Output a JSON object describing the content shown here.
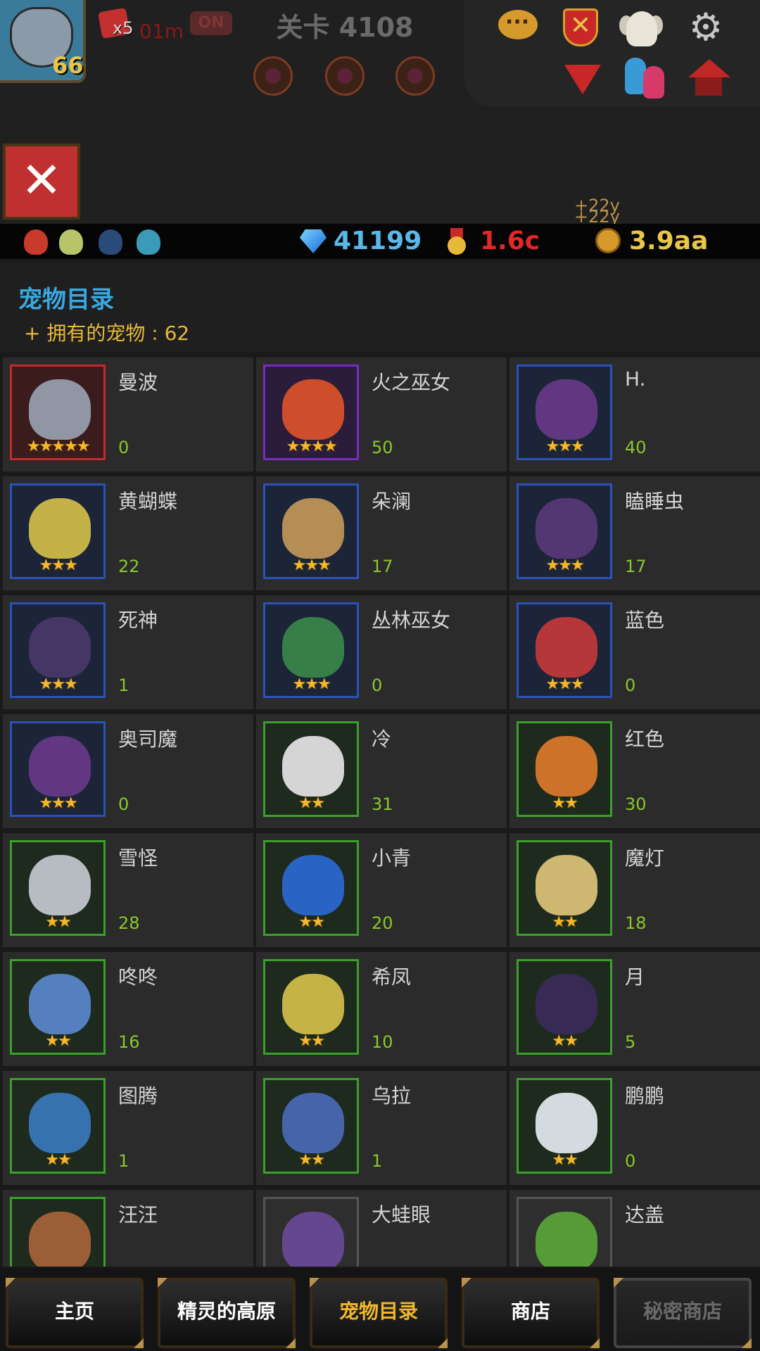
{
  "hud": {
    "level": "66",
    "boost_count": "x5",
    "boost_time": "01m",
    "boost_toggle": "ON",
    "stage_label": "关卡 4108",
    "floating_texts": [
      "+22y",
      "+22y"
    ]
  },
  "resources": {
    "gems": "41199",
    "medals": "1.6c",
    "gold": "3.9aa",
    "colors": {
      "gems": "#5ab8e8",
      "medals": "#e02828",
      "gold": "#e8c64a"
    }
  },
  "catalog": {
    "title": "宠物目录",
    "owned_label": "+ 拥有的宠物 : 62"
  },
  "pets": [
    {
      "name": "曼波",
      "count": "0",
      "stars": 5,
      "rarity": "red",
      "color": "#9aa4b4"
    },
    {
      "name": "火之巫女",
      "count": "50",
      "stars": 4,
      "rarity": "purple",
      "color": "#e0542a"
    },
    {
      "name": "H.",
      "count": "40",
      "stars": 3,
      "rarity": "blue",
      "color": "#6a3a8a"
    },
    {
      "name": "黄蝴蝶",
      "count": "22",
      "stars": 3,
      "rarity": "blue",
      "color": "#d6c24a"
    },
    {
      "name": "朵澜",
      "count": "17",
      "stars": 3,
      "rarity": "blue",
      "color": "#c69a5a"
    },
    {
      "name": "瞌睡虫",
      "count": "17",
      "stars": 3,
      "rarity": "blue",
      "color": "#5a3a7a"
    },
    {
      "name": "死神",
      "count": "1",
      "stars": 3,
      "rarity": "blue",
      "color": "#4a3a6a"
    },
    {
      "name": "丛林巫女",
      "count": "0",
      "stars": 3,
      "rarity": "blue",
      "color": "#3a8a4a"
    },
    {
      "name": "蓝色",
      "count": "0",
      "stars": 3,
      "rarity": "blue",
      "color": "#c83a3a"
    },
    {
      "name": "奥司魔",
      "count": "0",
      "stars": 3,
      "rarity": "blue",
      "color": "#6a3a8a"
    },
    {
      "name": "冷",
      "count": "31",
      "stars": 2,
      "rarity": "green",
      "color": "#e8e8e8"
    },
    {
      "name": "红色",
      "count": "30",
      "stars": 2,
      "rarity": "green",
      "color": "#e07a2a"
    },
    {
      "name": "雪怪",
      "count": "28",
      "stars": 2,
      "rarity": "green",
      "color": "#c8ccd4"
    },
    {
      "name": "小青",
      "count": "20",
      "stars": 2,
      "rarity": "green",
      "color": "#2a6ad6"
    },
    {
      "name": "魔灯",
      "count": "18",
      "stars": 2,
      "rarity": "green",
      "color": "#e0c67a"
    },
    {
      "name": "咚咚",
      "count": "16",
      "stars": 2,
      "rarity": "green",
      "color": "#5a8ad0"
    },
    {
      "name": "希凤",
      "count": "10",
      "stars": 2,
      "rarity": "green",
      "color": "#d6c24a"
    },
    {
      "name": "月",
      "count": "5",
      "stars": 2,
      "rarity": "green",
      "color": "#3a2a5a"
    },
    {
      "name": "图腾",
      "count": "1",
      "stars": 2,
      "rarity": "green",
      "color": "#3a7ac0"
    },
    {
      "name": "乌拉",
      "count": "1",
      "stars": 2,
      "rarity": "green",
      "color": "#4a6ab8"
    },
    {
      "name": "鹏鹏",
      "count": "0",
      "stars": 2,
      "rarity": "green",
      "color": "#e8eef4"
    },
    {
      "name": "汪汪",
      "count": "",
      "stars": 0,
      "rarity": "green",
      "color": "#a8643a"
    },
    {
      "name": "大蛙眼",
      "count": "",
      "stars": 0,
      "rarity": "gray",
      "color": "#6a4a9a"
    },
    {
      "name": "达盖",
      "count": "",
      "stars": 0,
      "rarity": "gray",
      "color": "#5aa83a"
    }
  ],
  "rarity_colors": {
    "red": "#c42a2a",
    "purple": "#7a2ac0",
    "blue": "#2a52b8",
    "green": "#3aa02a",
    "gray": "#555555"
  },
  "nav": [
    {
      "label": "主页",
      "state": "normal"
    },
    {
      "label": "精灵的高原",
      "state": "normal"
    },
    {
      "label": "宠物目录",
      "state": "active"
    },
    {
      "label": "商店",
      "state": "normal"
    },
    {
      "label": "秘密商店",
      "state": "disabled"
    }
  ]
}
